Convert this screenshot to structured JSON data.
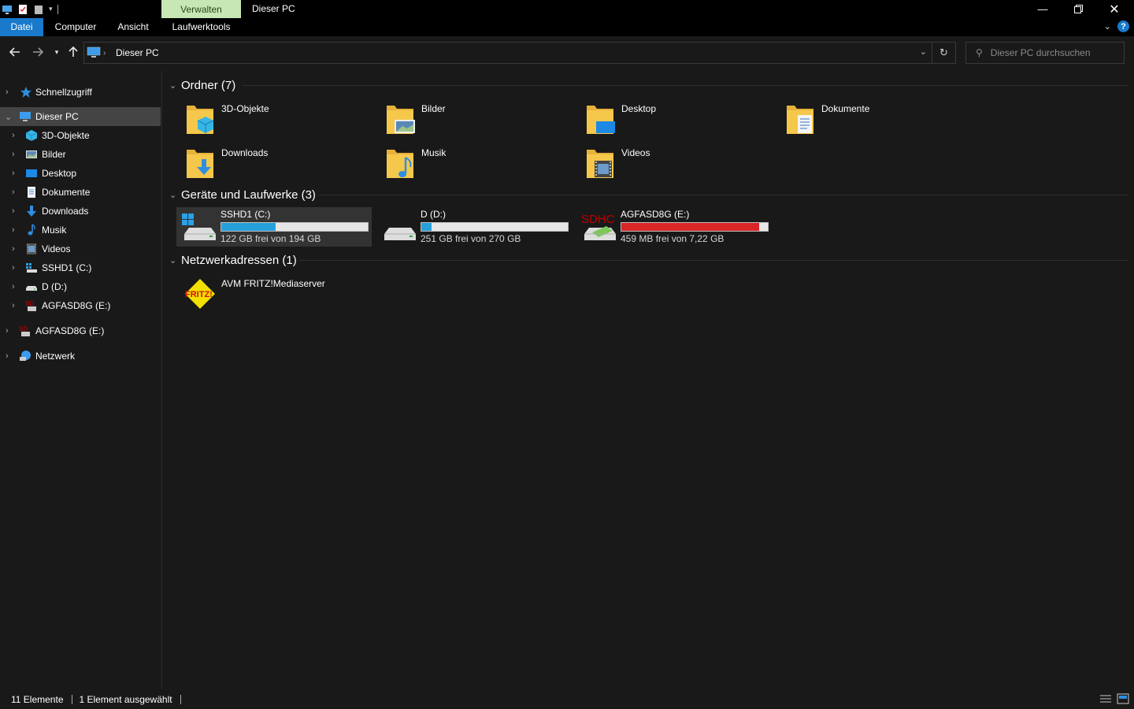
{
  "window": {
    "title": "Dieser PC",
    "manage_tab": "Verwalten"
  },
  "ribbon": {
    "tabs": [
      "Datei",
      "Computer",
      "Ansicht",
      "Laufwerktools"
    ],
    "help_label": "?"
  },
  "address": {
    "location": "Dieser PC",
    "search_placeholder": "Dieser PC durchsuchen"
  },
  "sidebar": {
    "items": [
      {
        "label": "Schnellzugriff",
        "icon": "star-icon"
      },
      {
        "label": "Dieser PC",
        "icon": "pc-icon",
        "selected": true
      },
      {
        "label": "3D-Objekte",
        "icon": "3d-objects-icon"
      },
      {
        "label": "Bilder",
        "icon": "pictures-icon"
      },
      {
        "label": "Desktop",
        "icon": "desktop-icon"
      },
      {
        "label": "Dokumente",
        "icon": "documents-icon"
      },
      {
        "label": "Downloads",
        "icon": "downloads-icon"
      },
      {
        "label": "Musik",
        "icon": "music-icon"
      },
      {
        "label": "Videos",
        "icon": "videos-icon"
      },
      {
        "label": "SSHD1 (C:)",
        "icon": "windows-drive-icon"
      },
      {
        "label": "D (D:)",
        "icon": "drive-icon"
      },
      {
        "label": "AGFASD8G (E:)",
        "icon": "sd-card-icon"
      },
      {
        "label": "AGFASD8G (E:)",
        "icon": "sd-card-icon"
      },
      {
        "label": "Netzwerk",
        "icon": "network-icon"
      }
    ]
  },
  "groups": {
    "folders_title": "Ordner (7)",
    "devices_title": "Geräte und Laufwerke (3)",
    "network_title": "Netzwerkadressen (1)"
  },
  "folders": [
    {
      "label": "3D-Objekte",
      "icon": "3d-objects-folder-icon"
    },
    {
      "label": "Bilder",
      "icon": "pictures-folder-icon"
    },
    {
      "label": "Desktop",
      "icon": "desktop-folder-icon"
    },
    {
      "label": "Dokumente",
      "icon": "documents-folder-icon"
    },
    {
      "label": "Downloads",
      "icon": "downloads-folder-icon"
    },
    {
      "label": "Musik",
      "icon": "music-folder-icon"
    },
    {
      "label": "Videos",
      "icon": "videos-folder-icon"
    }
  ],
  "drives": [
    {
      "name": "SSHD1 (C:)",
      "free": "122 GB frei von 194 GB",
      "used_fraction": 0.37,
      "bar_color": "#26a0da",
      "selected": true
    },
    {
      "name": "D (D:)",
      "free": "251 GB frei von 270 GB",
      "used_fraction": 0.07,
      "bar_color": "#26a0da",
      "selected": false
    },
    {
      "name": "AGFASD8G (E:)",
      "free": "459 MB frei von 7,22 GB",
      "sd_label": "SDHC",
      "used_fraction": 0.94,
      "bar_color": "#da2626",
      "selected": false
    }
  ],
  "network": [
    {
      "label": "AVM FRITZ!Mediaserver",
      "icon": "fritz-icon",
      "logo_text": "FRITZ!"
    }
  ],
  "status": {
    "count": "11 Elemente",
    "selected": "1 Element ausgewählt"
  },
  "colors": {
    "accent": "#1979ca",
    "manage_tab_bg": "#c7e7b5",
    "folder": "#f5c84c"
  }
}
